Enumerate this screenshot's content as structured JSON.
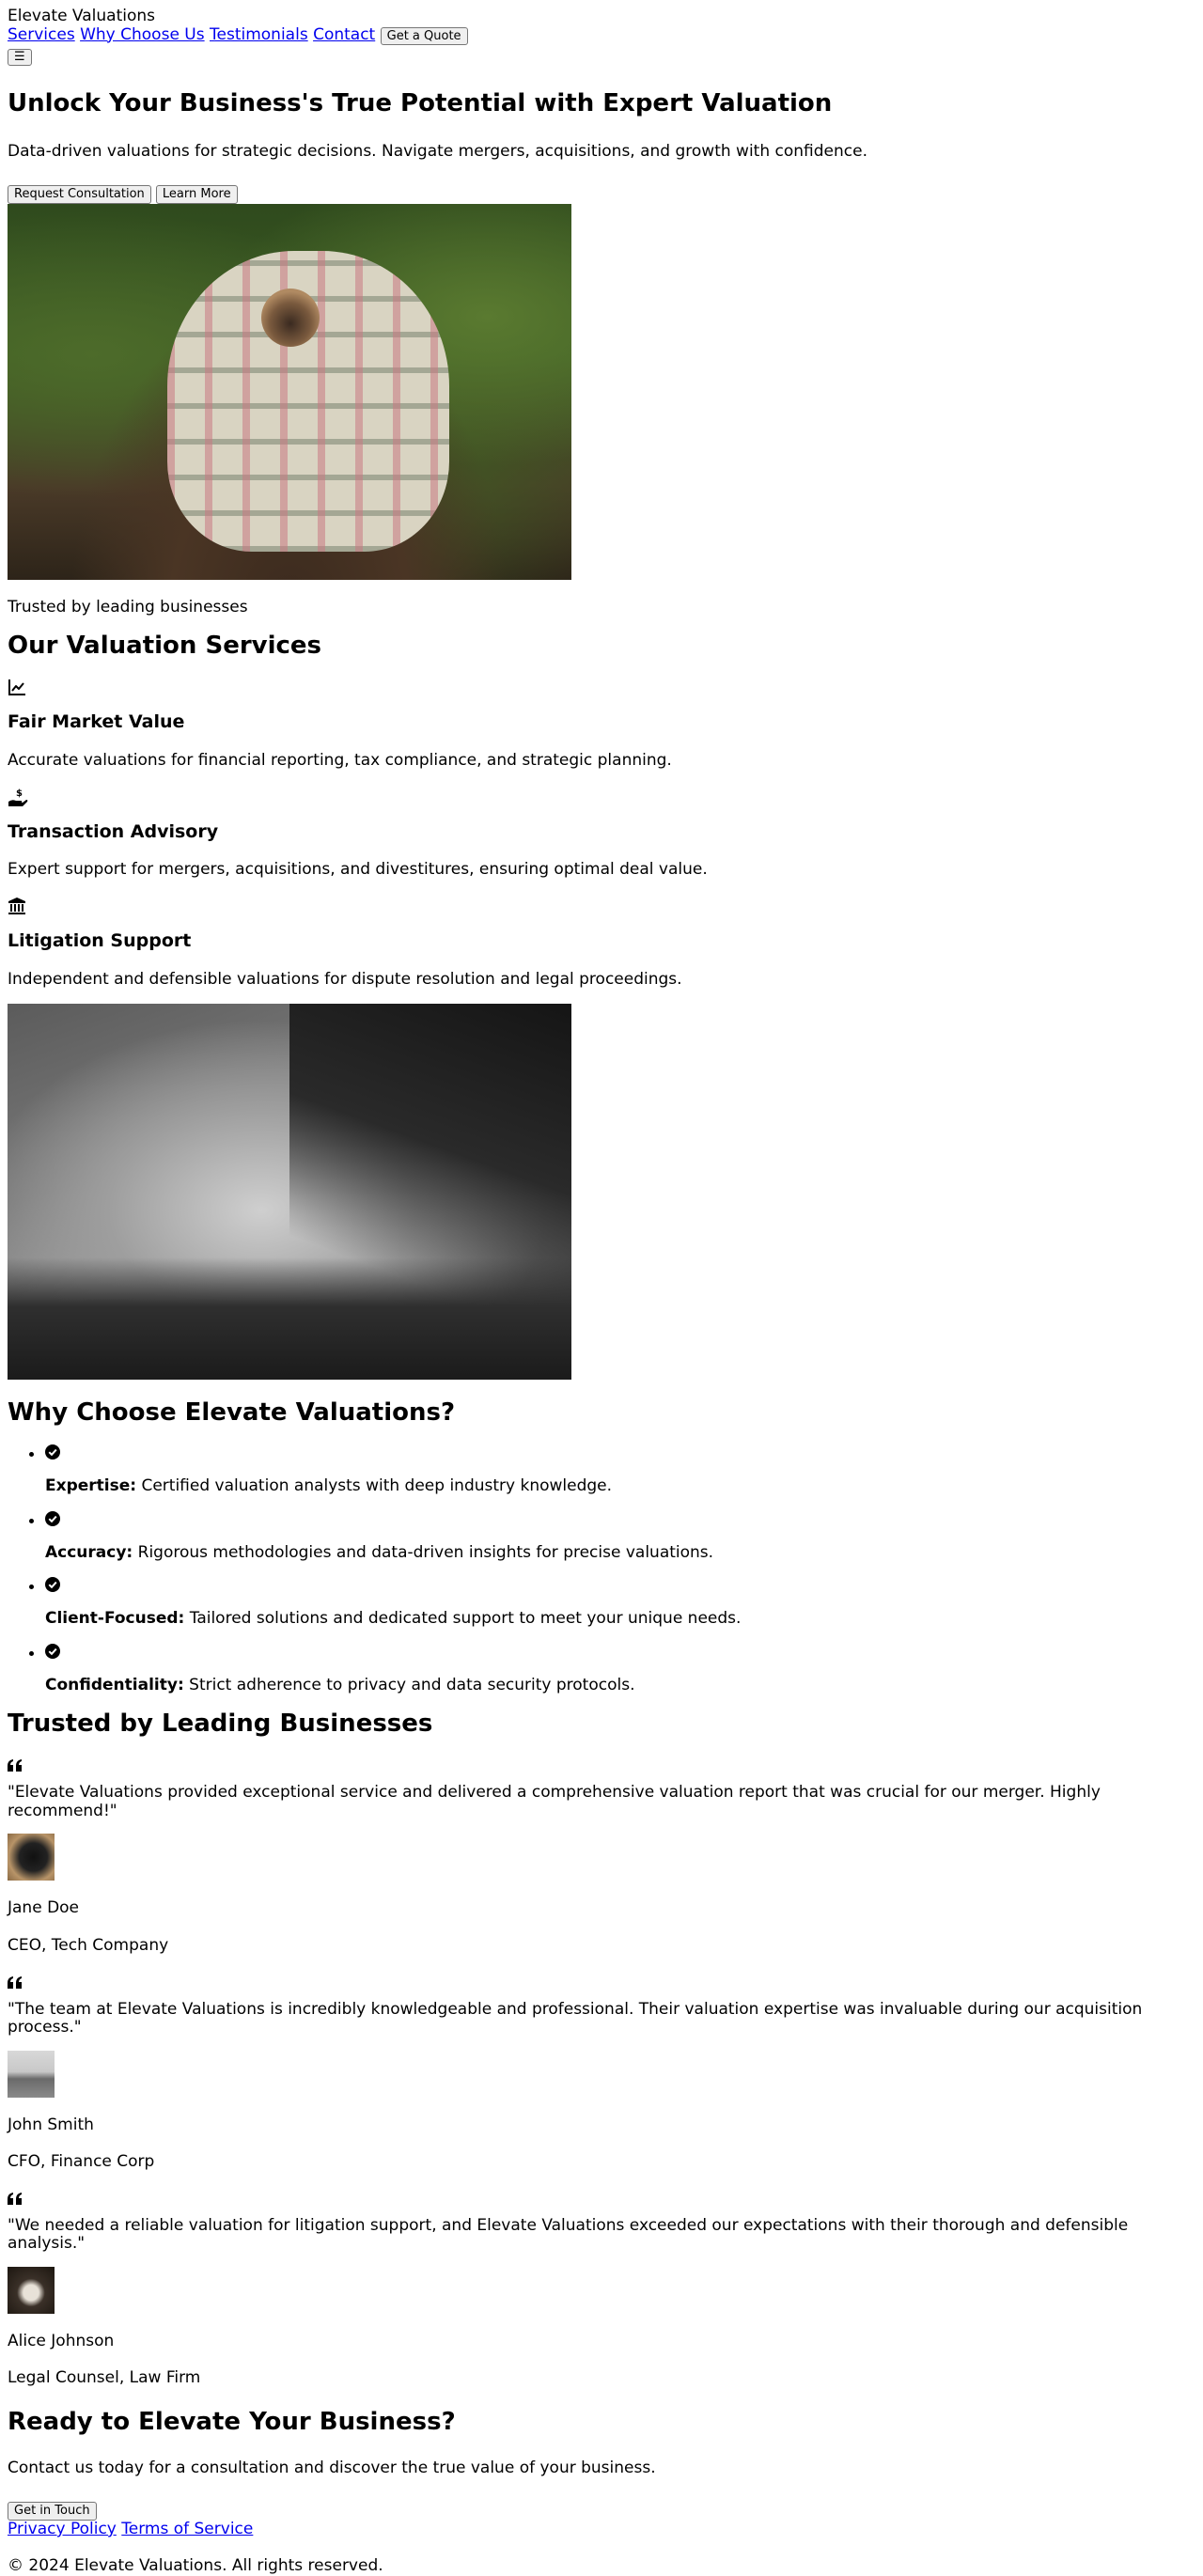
{
  "header": {
    "brand": "Elevate Valuations",
    "nav": [
      "Services",
      "Why Choose Us",
      "Testimonials",
      "Contact"
    ],
    "quote_button": "Get a Quote",
    "menu_button": "☰"
  },
  "hero": {
    "title": "Unlock Your Business's True Potential with Expert Valuation",
    "subtitle": "Data-driven valuations for strategic decisions. Navigate mergers, acquisitions, and growth with confidence.",
    "primary_button": "Request Consultation",
    "secondary_button": "Learn More",
    "trusted_note": "Trusted by leading businesses"
  },
  "services": {
    "title": "Our Valuation Services",
    "items": [
      {
        "icon": "chart-line-icon",
        "title": "Fair Market Value",
        "description": "Accurate valuations for financial reporting, tax compliance, and strategic planning."
      },
      {
        "icon": "hand-holding-dollar-icon",
        "title": "Transaction Advisory",
        "description": "Expert support for mergers, acquisitions, and divestitures, ensuring optimal deal value."
      },
      {
        "icon": "landmark-icon",
        "title": "Litigation Support",
        "description": "Independent and defensible valuations for dispute resolution and legal proceedings."
      }
    ]
  },
  "why": {
    "title": "Why Choose Elevate Valuations?",
    "items": [
      {
        "label": "Expertise:",
        "text": " Certified valuation analysts with deep industry knowledge."
      },
      {
        "label": "Accuracy:",
        "text": " Rigorous methodologies and data-driven insights for precise valuations."
      },
      {
        "label": "Client-Focused:",
        "text": " Tailored solutions and dedicated support to meet your unique needs."
      },
      {
        "label": "Confidentiality:",
        "text": " Strict adherence to privacy and data security protocols."
      }
    ]
  },
  "testimonials": {
    "title": "Trusted by Leading Businesses",
    "items": [
      {
        "quote": "\"Elevate Valuations provided exceptional service and delivered a comprehensive valuation report that was crucial for our merger. Highly recommend!\"",
        "name": "Jane Doe",
        "role": "CEO, Tech Company"
      },
      {
        "quote": "\"The team at Elevate Valuations is incredibly knowledgeable and professional. Their valuation expertise was invaluable during our acquisition process.\"",
        "name": "John Smith",
        "role": "CFO, Finance Corp"
      },
      {
        "quote": "\"We needed a reliable valuation for litigation support, and Elevate Valuations exceeded our expectations with their thorough and defensible analysis.\"",
        "name": "Alice Johnson",
        "role": "Legal Counsel, Law Firm"
      }
    ]
  },
  "cta": {
    "title": "Ready to Elevate Your Business?",
    "text": "Contact us today for a consultation and discover the true value of your business.",
    "button": "Get in Touch"
  },
  "footer": {
    "links": [
      "Privacy Policy",
      "Terms of Service"
    ],
    "copyright": "© 2024 Elevate Valuations. All rights reserved."
  }
}
